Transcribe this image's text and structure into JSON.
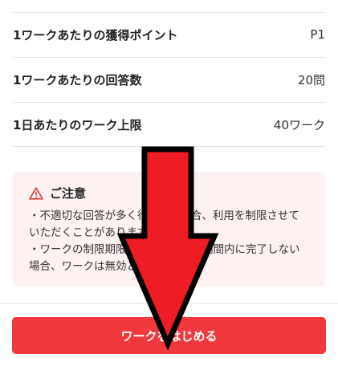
{
  "rows": [
    {
      "label": "1ワークあたりの獲得ポイント",
      "value": "P1"
    },
    {
      "label": "1ワークあたりの回答数",
      "value": "20問"
    },
    {
      "label": "1日あたりのワーク上限",
      "value": "40ワーク"
    }
  ],
  "notice": {
    "icon": "warning-icon",
    "title": "ご注意",
    "items": [
      "・不適切な回答が多く行われた場合、利用を制限させていただくことがあります。",
      "・ワークの制限期限を過ぎた場合、期間内に完了しない場合、ワークは無効となります。"
    ]
  },
  "button": {
    "label": "ワークをはじめる"
  },
  "colors": {
    "accent": "#f0383d",
    "notice_bg": "#fdf1f2",
    "arrow": "#ee1c24"
  }
}
